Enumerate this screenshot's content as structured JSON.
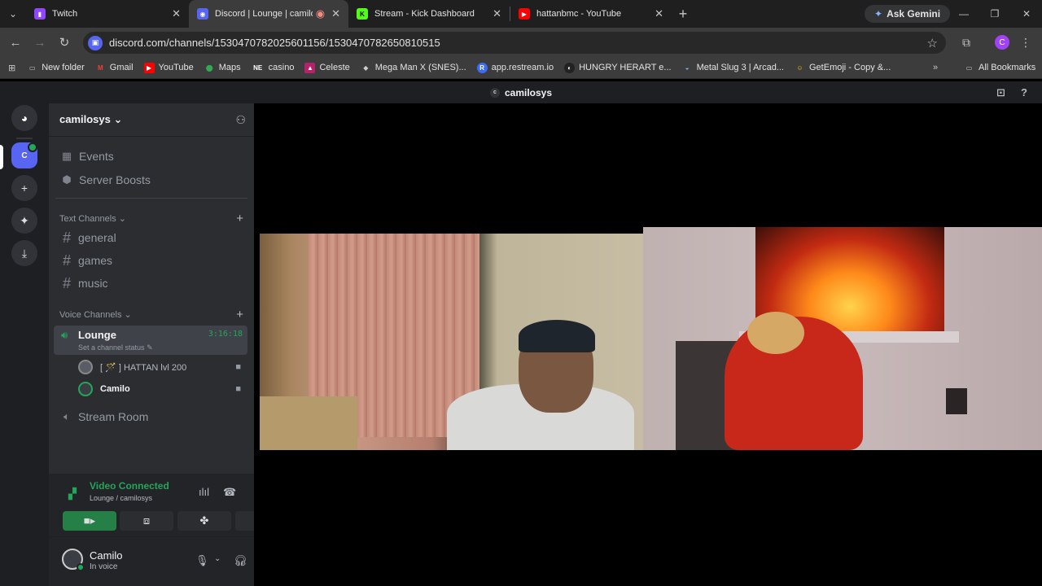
{
  "browser": {
    "tabs": [
      {
        "title": "Twitch",
        "icon": "twitch-icon",
        "color": "#9146ff",
        "active": false
      },
      {
        "title": "Discord | Lounge | camilosys",
        "icon": "discord-icon",
        "color": "#5865f2",
        "active": true
      },
      {
        "title": "Stream - Kick Dashboard",
        "icon": "kick-icon",
        "color": "#53fc18",
        "active": false
      },
      {
        "title": "hattanbmc - YouTube",
        "icon": "youtube-icon",
        "color": "#ff0000",
        "active": false
      }
    ],
    "ask_gemini": "Ask Gemini",
    "url": "discord.com/channels/1530470782025601156/1530470782650810515",
    "profile_initial": "C",
    "bookmarks": [
      {
        "label": "New folder",
        "icon": "folder-icon"
      },
      {
        "label": "Gmail",
        "icon": "gmail-icon"
      },
      {
        "label": "YouTube",
        "icon": "youtube-icon"
      },
      {
        "label": "Maps",
        "icon": "maps-icon"
      },
      {
        "label": "casino",
        "icon": "ne-icon"
      },
      {
        "label": "Celeste",
        "icon": "celeste-icon"
      },
      {
        "label": "Mega Man X (SNES)...",
        "icon": "megaman-icon"
      },
      {
        "label": "app.restream.io",
        "icon": "restream-icon"
      },
      {
        "label": "HUNGRY HERART e...",
        "icon": "hungry-icon"
      },
      {
        "label": "Metal Slug 3 | Arcad...",
        "icon": "metalslug-icon"
      },
      {
        "label": "GetEmoji - Copy &...",
        "icon": "emoji-icon"
      }
    ],
    "all_bookmarks": "All Bookmarks"
  },
  "discord": {
    "top_title": "camilosys",
    "server_initial": "c",
    "server_name": "camilosys",
    "guild_initial": "C",
    "menu": [
      {
        "label": "Events",
        "icon": "calendar-icon"
      },
      {
        "label": "Server Boosts",
        "icon": "boost-icon"
      }
    ],
    "text_category": "Text Channels",
    "text_channels": [
      "general",
      "games",
      "music"
    ],
    "voice_category": "Voice Channels",
    "lounge": {
      "name": "Lounge",
      "timer": "3:16:18",
      "status": "Set a channel status"
    },
    "members": [
      {
        "name": "[ 🪄 ] HATTAN lvl 200"
      },
      {
        "name": "Camilo"
      }
    ],
    "stream_room": "Stream Room",
    "voice_panel": {
      "title": "Video Connected",
      "subtitle": "Lounge / camilosys"
    },
    "user": {
      "name": "Camilo",
      "status": "In voice"
    },
    "colors": {
      "accent": "#5865f2",
      "connected": "#23a55a"
    }
  }
}
